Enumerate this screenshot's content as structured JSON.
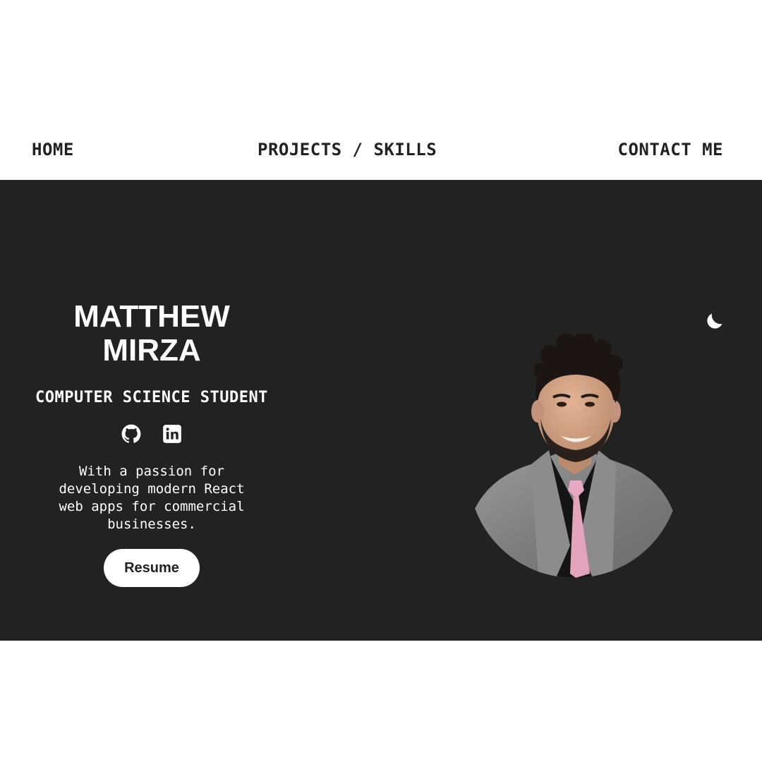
{
  "nav": {
    "home": "HOME",
    "projects": "PROJECTS / SKILLS",
    "contact": "CONTACT ME"
  },
  "hero": {
    "name": "MATTHEW MIRZA",
    "role": "COMPUTER SCIENCE STUDENT",
    "bio": "With a passion for developing modern React web apps for commercial businesses.",
    "resume_label": "Resume",
    "socials": [
      {
        "icon": "github-icon"
      },
      {
        "icon": "linkedin-icon"
      }
    ],
    "theme_icon": "moon-icon"
  },
  "colors": {
    "hero_background": "#222222",
    "nav_background": "#ffffff",
    "nav_text": "#222222",
    "hero_text": "#ffffff",
    "button_background": "#ffffff"
  }
}
